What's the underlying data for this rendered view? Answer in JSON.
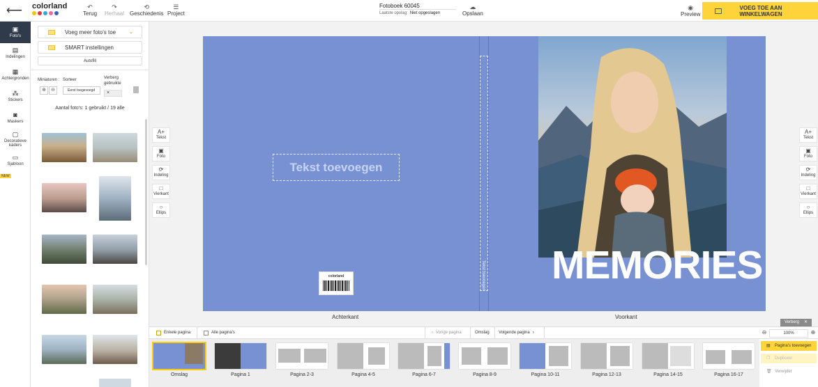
{
  "app": {
    "logo": "colorland"
  },
  "toolbar": {
    "undo": "Terug",
    "redo": "Herhaal",
    "history": "Geschiedenis",
    "project": "Project",
    "save": "Opslaan",
    "preview": "Preview",
    "add_to_cart": "VOEG TOE AAN WINKELWAGEN"
  },
  "document": {
    "title": "Fotoboek 60045",
    "last_saved_label": "Laatste opslag:",
    "last_saved_value": "Niet opgeslagen"
  },
  "rail": {
    "items": [
      {
        "label": "Foto's",
        "icon": "photos-icon"
      },
      {
        "label": "Indelingen",
        "icon": "layout-icon"
      },
      {
        "label": "Achtergronden",
        "icon": "background-icon"
      },
      {
        "label": "Stickers",
        "icon": "sticker-icon"
      },
      {
        "label": "Maskers",
        "icon": "mask-icon"
      },
      {
        "label": "Decoratieve kaders",
        "icon": "frame-icon"
      },
      {
        "label": "Sjabloon",
        "icon": "template-icon"
      }
    ],
    "new_badge": "NEW"
  },
  "panel": {
    "add_photos": "Voeg meer foto's toe",
    "smart": "SMART instellingen",
    "autofill": "Autofill",
    "thumbnails_label": "Miniaturen :",
    "sort_label": "Sorteer",
    "sort_value": "Eerst toegevoegd",
    "hide_used_label": "Verberg gebruikte",
    "count": "Aantal foto's: 1 gebruikt / 19 alle"
  },
  "canvas": {
    "text_placeholder": "Tekst toevoegen",
    "spine_text": "Tekst toevoegen",
    "barcode_logo": "colorland",
    "cover_title": "MEMORIES",
    "back_label": "Achterkant",
    "front_label": "Voorkant"
  },
  "side_tools": [
    {
      "label": "Tekst",
      "icon": "A+"
    },
    {
      "label": "Foto",
      "icon": "▣"
    },
    {
      "label": "Indeling",
      "icon": "⟳"
    },
    {
      "label": "Vierkant",
      "icon": "□"
    },
    {
      "label": "Ellips",
      "icon": "○"
    }
  ],
  "pagebar": {
    "single_pages": "Enkele pagina",
    "all_pages": "Alle pagina's",
    "prev_page": "Vorige pagina",
    "cover": "Omslag",
    "next_page": "Volgende pagina"
  },
  "pages": [
    "Omslag",
    "Pagina 1",
    "Pagina 2-3",
    "Pagina 4-5",
    "Pagina 6-7",
    "Pagina 8-9",
    "Pagina 10-11",
    "Pagina 12-13",
    "Pagina 14-15",
    "Pagina 16-17"
  ],
  "zoom": {
    "value": "100%"
  },
  "right_panel": {
    "hide": "Verberg",
    "add_pages": "Pagina's toevoegen",
    "duplicate": "Dupliceer",
    "remove": "Verwijder"
  },
  "colors": {
    "accent": "#ffd43b",
    "cover": "#7891d3",
    "rail_active": "#2f3a4a"
  }
}
